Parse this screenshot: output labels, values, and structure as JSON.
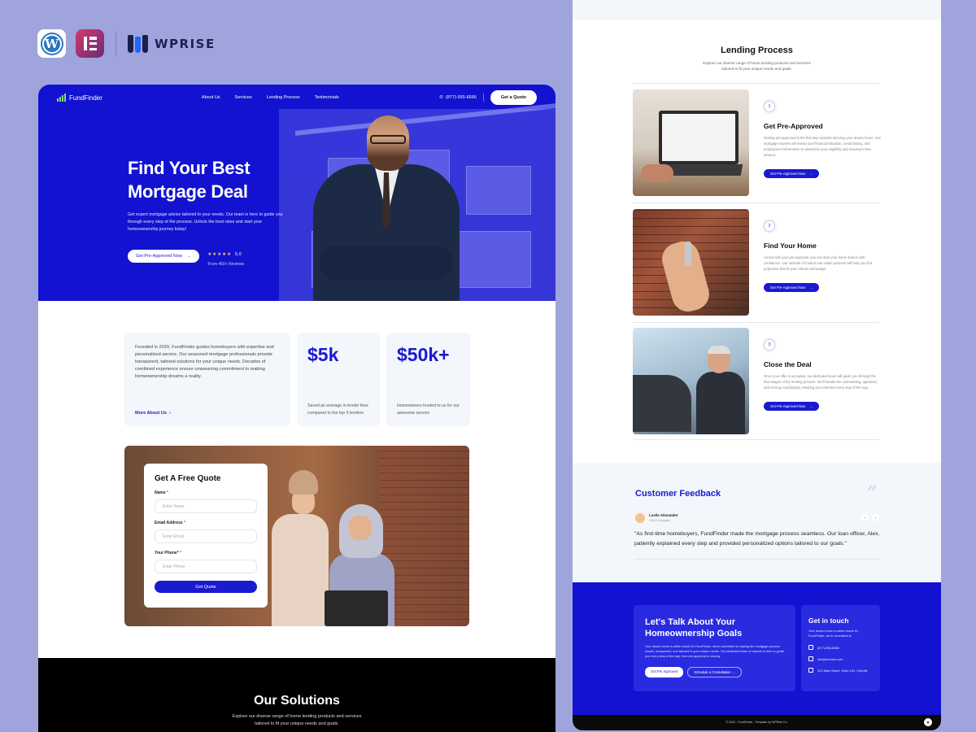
{
  "brand_bar": {
    "wordpress_icon": "wordpress-logo",
    "elementor_icon": "elementor-logo",
    "wprise_label": "WPRISE"
  },
  "left_page": {
    "nav": {
      "logo_text": "FundFinder",
      "links": [
        "About Us",
        "Services",
        "Lending Process",
        "Testimonials"
      ],
      "phone": "(877)-555-6666",
      "quote_button": "Get a Quote"
    },
    "hero": {
      "title_line1": "Find Your Best",
      "title_line2": "Mortgage Deal",
      "description": "Get expert mortgage advice tailored to your needs. Our team is here to guide you through every step of the process. Unlock the best rates and start your homeownership journey today!",
      "cta": "Get Pre-Approved Now",
      "stars": "★★★★★",
      "rating": "5.0",
      "reviews": "From 460+ Reviews"
    },
    "about": {
      "text": "Founded in 2020, FundFinder guides homebuyers with expertise and personalized service. Our seasoned mortgage professionals provide transparent, tailored solutions for your unique needs. Decades of combined experience ensure unwavering commitment to making homeownership dreams a reality.",
      "link": "More About Us",
      "stats": [
        {
          "value": "$5k",
          "desc": "Saved an average in lender fees compared to the top 5 lenders"
        },
        {
          "value": "$50k+",
          "desc": "Homeowners trusted to us for our awesome service"
        }
      ]
    },
    "quote_form": {
      "title": "Get A Free Quote",
      "fields": [
        {
          "label": "Name",
          "required": "*",
          "placeholder": "Enter Name"
        },
        {
          "label": "Email Address",
          "required": "*",
          "placeholder": "Enter Email"
        },
        {
          "label": "Your Phone*",
          "required": "*",
          "placeholder": "Enter Phone"
        }
      ],
      "submit": "Get Quote"
    },
    "solutions": {
      "title": "Our Solutions",
      "desc_line1": "Explore our diverse range of home lending products and services",
      "desc_line2": "tailored to fit your unique needs and goals."
    }
  },
  "right_page": {
    "lending": {
      "title": "Lending Process",
      "desc_line1": "Explore our diverse range of home lending products and services",
      "desc_line2": "tailored to fit your unique needs and goals.",
      "steps": [
        {
          "num": "1",
          "title": "Get Pre-Approved",
          "desc": "Getting pre-approved is the first step towards securing your dream home. Our mortgage experts will review your financial situation, credit history, and employment information to determine your eligibility and maximum loan amount.",
          "button": "Get Pre-Approved Now"
        },
        {
          "num": "2",
          "title": "Find Your Home",
          "desc": "Armed with your pre-approval, you can start your home search with confidence. Our network of trusted real estate partners will help you find properties that fit your criteria and budget.",
          "button": "Get Pre-Approved Now"
        },
        {
          "num": "3",
          "title": "Close the Deal",
          "desc": "Once your offer is accepted, our dedicated team will guide you through the final stages of the lending process. We'll handle the underwriting, appraisal, and closing coordination, keeping you informed every step of the way.",
          "button": "Get Pre-Approved Now"
        }
      ]
    },
    "feedback": {
      "title": "Customer Feedback",
      "name": "Leslie Alexander",
      "role": "UI/UX Designer",
      "quote": "\"As first-time homebuyers, FundFinder made the mortgage process seamless. Our loan officer, Alex, patiently explained every step and provided personalized options tailored to our goals.\"",
      "prev": "‹",
      "next": "›"
    },
    "cta": {
      "title_line1": "Let's Talk About Your",
      "title_line2": "Homeownership Goals",
      "desc": "Your dream home is within reach! At FundFinder, we're committed to making the mortgage process simple, transparent, and tailored to your unique needs. Our dedicated team of experts is here to guide you every step of the way, from pre-approval to closing.",
      "button1": "Get Pre Approved",
      "button2": "Schedule a Consultation"
    },
    "touch": {
      "title": "Get in touch",
      "desc": "Your dream home is within reach! At FundFinder, we're committed to",
      "phone": "(877)-555-6666",
      "email": "info@domain.com",
      "address": "123 Main Street, Suite 101, Cityville"
    },
    "footer": {
      "text": "© 2024 - FundFinder - Template by WPRise Co.",
      "scroll_top": "▲"
    }
  }
}
